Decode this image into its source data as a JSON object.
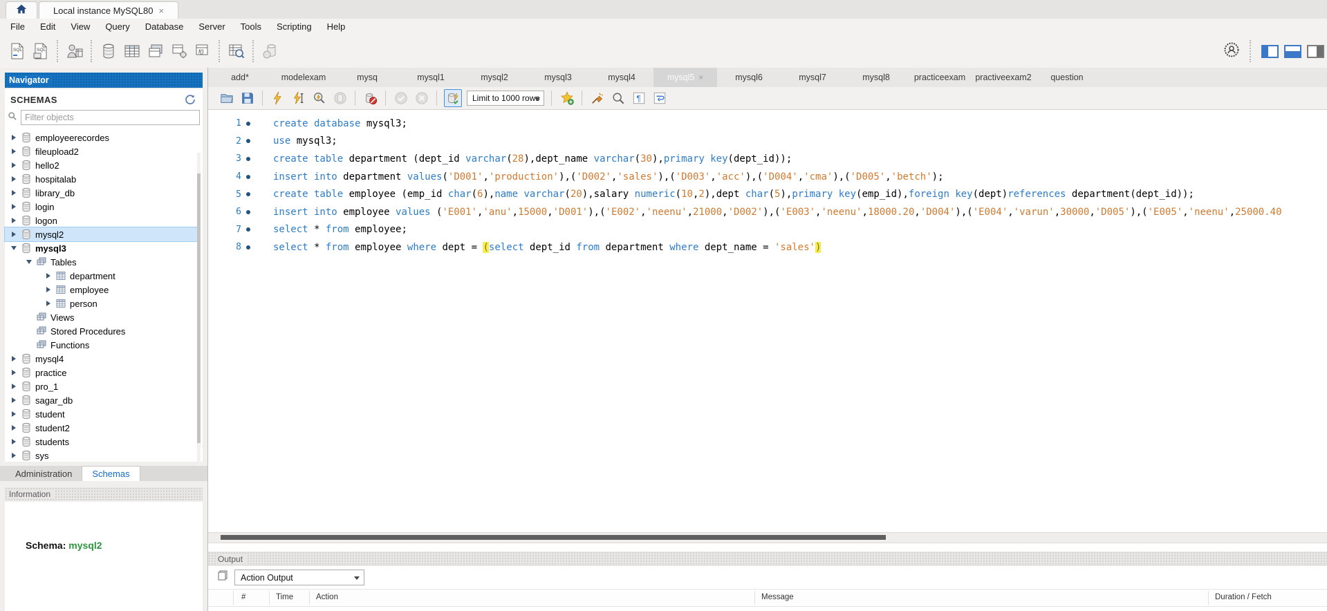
{
  "titlebar": {
    "connection_tab": "Local instance MySQL80",
    "close_glyph": "×"
  },
  "menubar": {
    "items": [
      "File",
      "Edit",
      "View",
      "Query",
      "Database",
      "Server",
      "Tools",
      "Scripting",
      "Help"
    ]
  },
  "main_toolbar": {
    "icons": [
      "new-sql-tab",
      "open-sql-script",
      "connection-inspector",
      "create-schema",
      "create-table",
      "create-view",
      "create-procedure",
      "create-function",
      "search-data",
      "reconnect-server"
    ]
  },
  "panel_toggles": [
    "toggle-left-panel",
    "toggle-bottom-panel",
    "toggle-right-panel"
  ],
  "query_tabs": {
    "tabs": [
      {
        "label": "add*",
        "active": false
      },
      {
        "label": "modelexam",
        "active": false
      },
      {
        "label": "mysq",
        "active": false
      },
      {
        "label": "mysql1",
        "active": false
      },
      {
        "label": "mysql2",
        "active": false
      },
      {
        "label": "mysql3",
        "active": false
      },
      {
        "label": "mysql4",
        "active": false
      },
      {
        "label": "mysql5",
        "active": true,
        "close": "×"
      },
      {
        "label": "mysql6",
        "active": false
      },
      {
        "label": "mysql7",
        "active": false
      },
      {
        "label": "mysql8",
        "active": false
      },
      {
        "label": "practiceexam",
        "active": false
      },
      {
        "label": "practiveexam2",
        "active": false
      },
      {
        "label": "question",
        "active": false
      }
    ]
  },
  "editor_toolbar": {
    "icons_left": [
      "open-script",
      "save-script",
      "execute",
      "execute-current",
      "explain",
      "stop",
      "toggle-stop-on-error",
      "commit",
      "rollback",
      "toggle-autocommit"
    ],
    "limit_label": "Limit to 1000 rows",
    "icons_right": [
      "new-snippet",
      "beautify",
      "find",
      "toggle-invisible-chars",
      "toggle-wrap"
    ]
  },
  "sql_editor": {
    "lines": [
      {
        "num": "1",
        "segments": [
          {
            "t": "create database",
            "c": "k"
          },
          {
            "t": " mysql3;",
            "c": "p"
          }
        ]
      },
      {
        "num": "2",
        "segments": [
          {
            "t": "use",
            "c": "k"
          },
          {
            "t": " mysql3;",
            "c": "p"
          }
        ]
      },
      {
        "num": "3",
        "segments": [
          {
            "t": "create table",
            "c": "k"
          },
          {
            "t": " department (dept_id ",
            "c": "p"
          },
          {
            "t": "varchar",
            "c": "k"
          },
          {
            "t": "(",
            "c": "p"
          },
          {
            "t": "28",
            "c": "n"
          },
          {
            "t": "),dept_name ",
            "c": "p"
          },
          {
            "t": "varchar",
            "c": "k"
          },
          {
            "t": "(",
            "c": "p"
          },
          {
            "t": "30",
            "c": "n"
          },
          {
            "t": "),",
            "c": "p"
          },
          {
            "t": "primary key",
            "c": "k"
          },
          {
            "t": "(dept_id));",
            "c": "p"
          }
        ]
      },
      {
        "num": "4",
        "segments": [
          {
            "t": "insert into",
            "c": "k"
          },
          {
            "t": " department ",
            "c": "p"
          },
          {
            "t": "values",
            "c": "k"
          },
          {
            "t": "(",
            "c": "p"
          },
          {
            "t": "'D001'",
            "c": "s"
          },
          {
            "t": ",",
            "c": "p"
          },
          {
            "t": "'production'",
            "c": "s"
          },
          {
            "t": "),(",
            "c": "p"
          },
          {
            "t": "'D002'",
            "c": "s"
          },
          {
            "t": ",",
            "c": "p"
          },
          {
            "t": "'sales'",
            "c": "s"
          },
          {
            "t": "),(",
            "c": "p"
          },
          {
            "t": "'D003'",
            "c": "s"
          },
          {
            "t": ",",
            "c": "p"
          },
          {
            "t": "'acc'",
            "c": "s"
          },
          {
            "t": "),(",
            "c": "p"
          },
          {
            "t": "'D004'",
            "c": "s"
          },
          {
            "t": ",",
            "c": "p"
          },
          {
            "t": "'cma'",
            "c": "s"
          },
          {
            "t": "),(",
            "c": "p"
          },
          {
            "t": "'D005'",
            "c": "s"
          },
          {
            "t": ",",
            "c": "p"
          },
          {
            "t": "'betch'",
            "c": "s"
          },
          {
            "t": ");",
            "c": "p"
          }
        ]
      },
      {
        "num": "5",
        "segments": [
          {
            "t": "create table",
            "c": "k"
          },
          {
            "t": " employee (emp_id ",
            "c": "p"
          },
          {
            "t": "char",
            "c": "k"
          },
          {
            "t": "(",
            "c": "p"
          },
          {
            "t": "6",
            "c": "n"
          },
          {
            "t": "),",
            "c": "p"
          },
          {
            "t": "name",
            "c": "k"
          },
          {
            "t": " ",
            "c": "p"
          },
          {
            "t": "varchar",
            "c": "k"
          },
          {
            "t": "(",
            "c": "p"
          },
          {
            "t": "20",
            "c": "n"
          },
          {
            "t": "),salary ",
            "c": "p"
          },
          {
            "t": "numeric",
            "c": "k"
          },
          {
            "t": "(",
            "c": "p"
          },
          {
            "t": "10",
            "c": "n"
          },
          {
            "t": ",",
            "c": "p"
          },
          {
            "t": "2",
            "c": "n"
          },
          {
            "t": "),dept ",
            "c": "p"
          },
          {
            "t": "char",
            "c": "k"
          },
          {
            "t": "(",
            "c": "p"
          },
          {
            "t": "5",
            "c": "n"
          },
          {
            "t": "),",
            "c": "p"
          },
          {
            "t": "primary key",
            "c": "k"
          },
          {
            "t": "(emp_id),",
            "c": "p"
          },
          {
            "t": "foreign key",
            "c": "k"
          },
          {
            "t": "(dept)",
            "c": "p"
          },
          {
            "t": "references",
            "c": "k"
          },
          {
            "t": " department(dept_id));",
            "c": "p"
          }
        ]
      },
      {
        "num": "6",
        "segments": [
          {
            "t": "insert into",
            "c": "k"
          },
          {
            "t": " employee ",
            "c": "p"
          },
          {
            "t": "values",
            "c": "k"
          },
          {
            "t": " (",
            "c": "p"
          },
          {
            "t": "'E001'",
            "c": "s"
          },
          {
            "t": ",",
            "c": "p"
          },
          {
            "t": "'anu'",
            "c": "s"
          },
          {
            "t": ",",
            "c": "p"
          },
          {
            "t": "15000",
            "c": "n"
          },
          {
            "t": ",",
            "c": "p"
          },
          {
            "t": "'D001'",
            "c": "s"
          },
          {
            "t": "),(",
            "c": "p"
          },
          {
            "t": "'E002'",
            "c": "s"
          },
          {
            "t": ",",
            "c": "p"
          },
          {
            "t": "'neenu'",
            "c": "s"
          },
          {
            "t": ",",
            "c": "p"
          },
          {
            "t": "21000",
            "c": "n"
          },
          {
            "t": ",",
            "c": "p"
          },
          {
            "t": "'D002'",
            "c": "s"
          },
          {
            "t": "),(",
            "c": "p"
          },
          {
            "t": "'E003'",
            "c": "s"
          },
          {
            "t": ",",
            "c": "p"
          },
          {
            "t": "'neenu'",
            "c": "s"
          },
          {
            "t": ",",
            "c": "p"
          },
          {
            "t": "18000.20",
            "c": "n"
          },
          {
            "t": ",",
            "c": "p"
          },
          {
            "t": "'D004'",
            "c": "s"
          },
          {
            "t": "),(",
            "c": "p"
          },
          {
            "t": "'E004'",
            "c": "s"
          },
          {
            "t": ",",
            "c": "p"
          },
          {
            "t": "'varun'",
            "c": "s"
          },
          {
            "t": ",",
            "c": "p"
          },
          {
            "t": "30000",
            "c": "n"
          },
          {
            "t": ",",
            "c": "p"
          },
          {
            "t": "'D005'",
            "c": "s"
          },
          {
            "t": "),(",
            "c": "p"
          },
          {
            "t": "'E005'",
            "c": "s"
          },
          {
            "t": ",",
            "c": "p"
          },
          {
            "t": "'neenu'",
            "c": "s"
          },
          {
            "t": ",",
            "c": "p"
          },
          {
            "t": "25000.40",
            "c": "n"
          }
        ]
      },
      {
        "num": "7",
        "segments": [
          {
            "t": "select",
            "c": "k"
          },
          {
            "t": " * ",
            "c": "p"
          },
          {
            "t": "from",
            "c": "k"
          },
          {
            "t": " employee;",
            "c": "p"
          }
        ]
      },
      {
        "num": "8",
        "segments": [
          {
            "t": "select",
            "c": "k"
          },
          {
            "t": " * ",
            "c": "p"
          },
          {
            "t": "from",
            "c": "k"
          },
          {
            "t": " employee ",
            "c": "p"
          },
          {
            "t": "where",
            "c": "k"
          },
          {
            "t": " dept = ",
            "c": "p"
          },
          {
            "t": "(",
            "c": "h"
          },
          {
            "t": "select",
            "c": "k"
          },
          {
            "t": " dept_id ",
            "c": "p"
          },
          {
            "t": "from",
            "c": "k"
          },
          {
            "t": " department ",
            "c": "p"
          },
          {
            "t": "where",
            "c": "k"
          },
          {
            "t": " dept_name = ",
            "c": "p"
          },
          {
            "t": "'sales'",
            "c": "s"
          },
          {
            "t": ")",
            "c": "h"
          }
        ]
      }
    ]
  },
  "sidebar": {
    "navigator_title": "Navigator",
    "schemas_title": "SCHEMAS",
    "filter_placeholder": "Filter objects",
    "tree": [
      {
        "label": "employeerecordes",
        "level": 0,
        "icon": "schema",
        "arrow": "right"
      },
      {
        "label": "fileupload2",
        "level": 0,
        "icon": "schema",
        "arrow": "right"
      },
      {
        "label": "hello2",
        "level": 0,
        "icon": "schema",
        "arrow": "right"
      },
      {
        "label": "hospitalab",
        "level": 0,
        "icon": "schema",
        "arrow": "right"
      },
      {
        "label": "library_db",
        "level": 0,
        "icon": "schema",
        "arrow": "right"
      },
      {
        "label": "login",
        "level": 0,
        "icon": "schema",
        "arrow": "right"
      },
      {
        "label": "logon",
        "level": 0,
        "icon": "schema",
        "arrow": "right"
      },
      {
        "label": "mysql2",
        "level": 0,
        "icon": "schema",
        "arrow": "right",
        "selected": true
      },
      {
        "label": "mysql3",
        "level": 0,
        "icon": "schema",
        "arrow": "down",
        "bold": true
      },
      {
        "label": "Tables",
        "level": 1,
        "icon": "tables",
        "arrow": "down"
      },
      {
        "label": "department",
        "level": 2,
        "icon": "table",
        "arrow": "right"
      },
      {
        "label": "employee",
        "level": 2,
        "icon": "table",
        "arrow": "right"
      },
      {
        "label": "person",
        "level": 2,
        "icon": "table",
        "arrow": "right"
      },
      {
        "label": "Views",
        "level": 1,
        "icon": "tables",
        "arrow": "none"
      },
      {
        "label": "Stored Procedures",
        "level": 1,
        "icon": "tables",
        "arrow": "none"
      },
      {
        "label": "Functions",
        "level": 1,
        "icon": "tables",
        "arrow": "none"
      },
      {
        "label": "mysql4",
        "level": 0,
        "icon": "schema",
        "arrow": "right"
      },
      {
        "label": "practice",
        "level": 0,
        "icon": "schema",
        "arrow": "right"
      },
      {
        "label": "pro_1",
        "level": 0,
        "icon": "schema",
        "arrow": "right"
      },
      {
        "label": "sagar_db",
        "level": 0,
        "icon": "schema",
        "arrow": "right"
      },
      {
        "label": "student",
        "level": 0,
        "icon": "schema",
        "arrow": "right"
      },
      {
        "label": "student2",
        "level": 0,
        "icon": "schema",
        "arrow": "right"
      },
      {
        "label": "students",
        "level": 0,
        "icon": "schema",
        "arrow": "right"
      },
      {
        "label": "sys",
        "level": 0,
        "icon": "schema",
        "arrow": "right"
      }
    ],
    "tabs": [
      {
        "label": "Administration",
        "active": false
      },
      {
        "label": "Schemas",
        "active": true
      }
    ],
    "information_title": "Information",
    "schema_label": "Schema:",
    "schema_value": "mysql2"
  },
  "output": {
    "title": "Output",
    "view_selector": "Action Output",
    "columns": [
      "#",
      "Time",
      "Action",
      "Message",
      "Duration / Fetch"
    ]
  },
  "colors": {
    "accent_blue": "#1673c1",
    "keyword_blue": "#2f7bc7",
    "literal_orange": "#cf7a32",
    "selection_blue": "#cfe6fa",
    "schema_green": "#2e9440",
    "paren_highlight": "#f3ee52"
  }
}
